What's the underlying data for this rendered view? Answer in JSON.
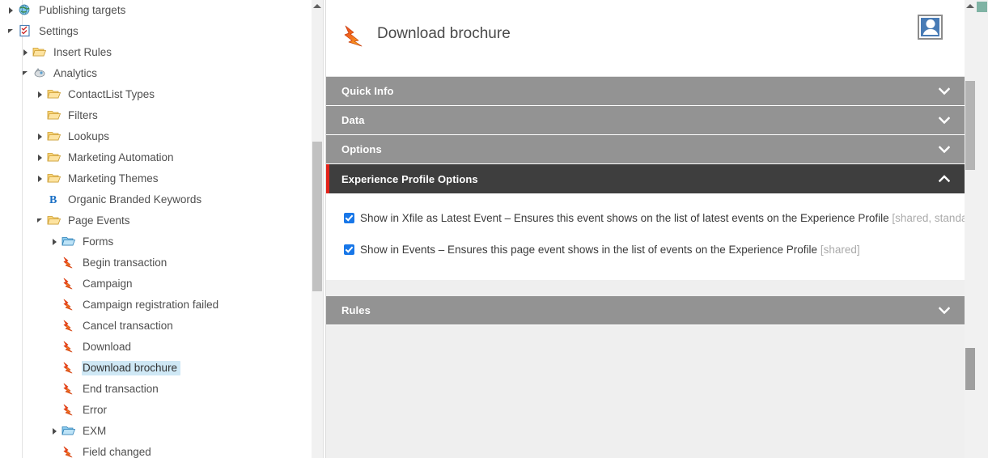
{
  "tree": {
    "items": [
      {
        "label": "Publishing targets",
        "icon": "globe-icon",
        "indent": 42,
        "arrow": "collapsed",
        "selected": false
      },
      {
        "label": "Settings",
        "icon": "settings-icon",
        "indent": 42,
        "arrow": "expanded",
        "selected": false
      },
      {
        "label": "Insert Rules",
        "icon": "folder-icon",
        "indent": 60,
        "arrow": "collapsed",
        "selected": false
      },
      {
        "label": "Analytics",
        "icon": "analytics-icon",
        "indent": 60,
        "arrow": "expanded",
        "selected": false
      },
      {
        "label": "ContactList Types",
        "icon": "folder-icon",
        "indent": 78,
        "arrow": "collapsed",
        "selected": false
      },
      {
        "label": "Filters",
        "icon": "folder-icon",
        "indent": 78,
        "arrow": "none",
        "selected": false
      },
      {
        "label": "Lookups",
        "icon": "folder-icon",
        "indent": 78,
        "arrow": "collapsed",
        "selected": false
      },
      {
        "label": "Marketing Automation",
        "icon": "folder-icon",
        "indent": 78,
        "arrow": "collapsed",
        "selected": false
      },
      {
        "label": "Marketing Themes",
        "icon": "folder-icon",
        "indent": 78,
        "arrow": "collapsed",
        "selected": false
      },
      {
        "label": "Organic Branded Keywords",
        "icon": "bing-icon",
        "indent": 78,
        "arrow": "none",
        "selected": false
      },
      {
        "label": "Page Events",
        "icon": "folder-icon",
        "indent": 78,
        "arrow": "expanded",
        "selected": false
      },
      {
        "label": "Forms",
        "icon": "folder-blue-icon",
        "indent": 96,
        "arrow": "collapsed",
        "selected": false
      },
      {
        "label": "Begin transaction",
        "icon": "lightning-icon",
        "indent": 96,
        "arrow": "none",
        "selected": false
      },
      {
        "label": "Campaign",
        "icon": "lightning-icon",
        "indent": 96,
        "arrow": "none",
        "selected": false
      },
      {
        "label": "Campaign registration failed",
        "icon": "lightning-icon",
        "indent": 96,
        "arrow": "none",
        "selected": false
      },
      {
        "label": "Cancel transaction",
        "icon": "lightning-icon",
        "indent": 96,
        "arrow": "none",
        "selected": false
      },
      {
        "label": "Download",
        "icon": "lightning-icon",
        "indent": 96,
        "arrow": "none",
        "selected": false
      },
      {
        "label": "Download brochure",
        "icon": "lightning-icon",
        "indent": 96,
        "arrow": "none",
        "selected": true
      },
      {
        "label": "End transaction",
        "icon": "lightning-icon",
        "indent": 96,
        "arrow": "none",
        "selected": false
      },
      {
        "label": "Error",
        "icon": "lightning-icon",
        "indent": 96,
        "arrow": "none",
        "selected": false
      },
      {
        "label": "EXM",
        "icon": "folder-blue-icon",
        "indent": 96,
        "arrow": "collapsed",
        "selected": false
      },
      {
        "label": "Field changed",
        "icon": "lightning-icon",
        "indent": 96,
        "arrow": "none",
        "selected": false
      }
    ]
  },
  "content": {
    "header": {
      "title": "Download brochure",
      "item_icon": "lightning-icon",
      "avatar_icon": "user-avatar-icon"
    },
    "sections": [
      {
        "title": "Quick Info",
        "state": "collapsed",
        "chevron": "chevron-down-icon"
      },
      {
        "title": "Data",
        "state": "collapsed",
        "chevron": "chevron-down-icon"
      },
      {
        "title": "Options",
        "state": "collapsed",
        "chevron": "chevron-down-icon"
      },
      {
        "title": "Experience Profile Options",
        "state": "expanded",
        "chevron": "chevron-up-icon"
      },
      {
        "title": "Rules",
        "state": "collapsed",
        "chevron": "chevron-down-icon"
      }
    ],
    "experience_profile_options": {
      "checkboxes": [
        {
          "checked": true,
          "label": "Show in Xfile as Latest Event – Ensures this event shows on the list of latest events on the Experience Profile",
          "note": "[shared, standard value]"
        },
        {
          "checked": true,
          "label": "Show in Events – Ensures this page event shows in the list of events on the Experience Profile",
          "note": "[shared]"
        }
      ]
    }
  },
  "colors": {
    "accent_red": "#e2231a",
    "bar_gray": "#939393",
    "bar_active": "#3e3e3e",
    "checkbox_blue": "#1877e8",
    "selection_blue": "#cfe8f5"
  }
}
